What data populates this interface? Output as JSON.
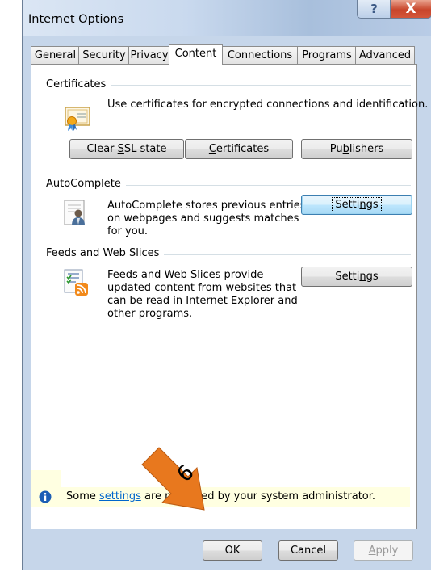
{
  "window": {
    "title": "Internet Options",
    "help_glyph": "?",
    "close_glyph": "X"
  },
  "tabs": [
    {
      "label": "General"
    },
    {
      "label": "Security"
    },
    {
      "label": "Privacy"
    },
    {
      "label": "Content",
      "active": true
    },
    {
      "label": "Connections"
    },
    {
      "label": "Programs"
    },
    {
      "label": "Advanced"
    }
  ],
  "certificates": {
    "heading": "Certificates",
    "description": "Use certificates for encrypted connections and identification.",
    "clear_ssl_label_pre": "Clear ",
    "clear_ssl_label_key": "S",
    "clear_ssl_label_post": "SL state",
    "certificates_label_key": "C",
    "certificates_label_post": "ertificates",
    "publishers_label_pre": "Pu",
    "publishers_label_key": "b",
    "publishers_label_post": "lishers"
  },
  "autocomplete": {
    "heading": "AutoComplete",
    "description_lines": [
      "AutoComplete stores previous entries",
      "on webpages and suggests matches",
      "for you."
    ],
    "settings_pre": "Setti",
    "settings_key": "n",
    "settings_post": "gs"
  },
  "feeds": {
    "heading": "Feeds and Web Slices",
    "description_lines": [
      "Feeds and Web Slices provide",
      "updated content from websites that",
      "can be read in Internet Explorer and",
      "other programs."
    ],
    "settings_pre": "Setti",
    "settings_key": "n",
    "settings_post": "gs"
  },
  "info": {
    "text_pre": "Some ",
    "link_text": "settings",
    "text_post": " are managed by your system administrator."
  },
  "annotation": {
    "step_number": "6",
    "color": "#e8781e"
  },
  "footer": {
    "ok_label": "OK",
    "cancel_label": "Cancel",
    "apply_label_key": "A",
    "apply_label_post": "pply"
  },
  "colors": {
    "title_bar": "#c9d9ee",
    "close_button": "#c8452b",
    "info_bar": "#ffffe1",
    "link": "#0066cc"
  }
}
